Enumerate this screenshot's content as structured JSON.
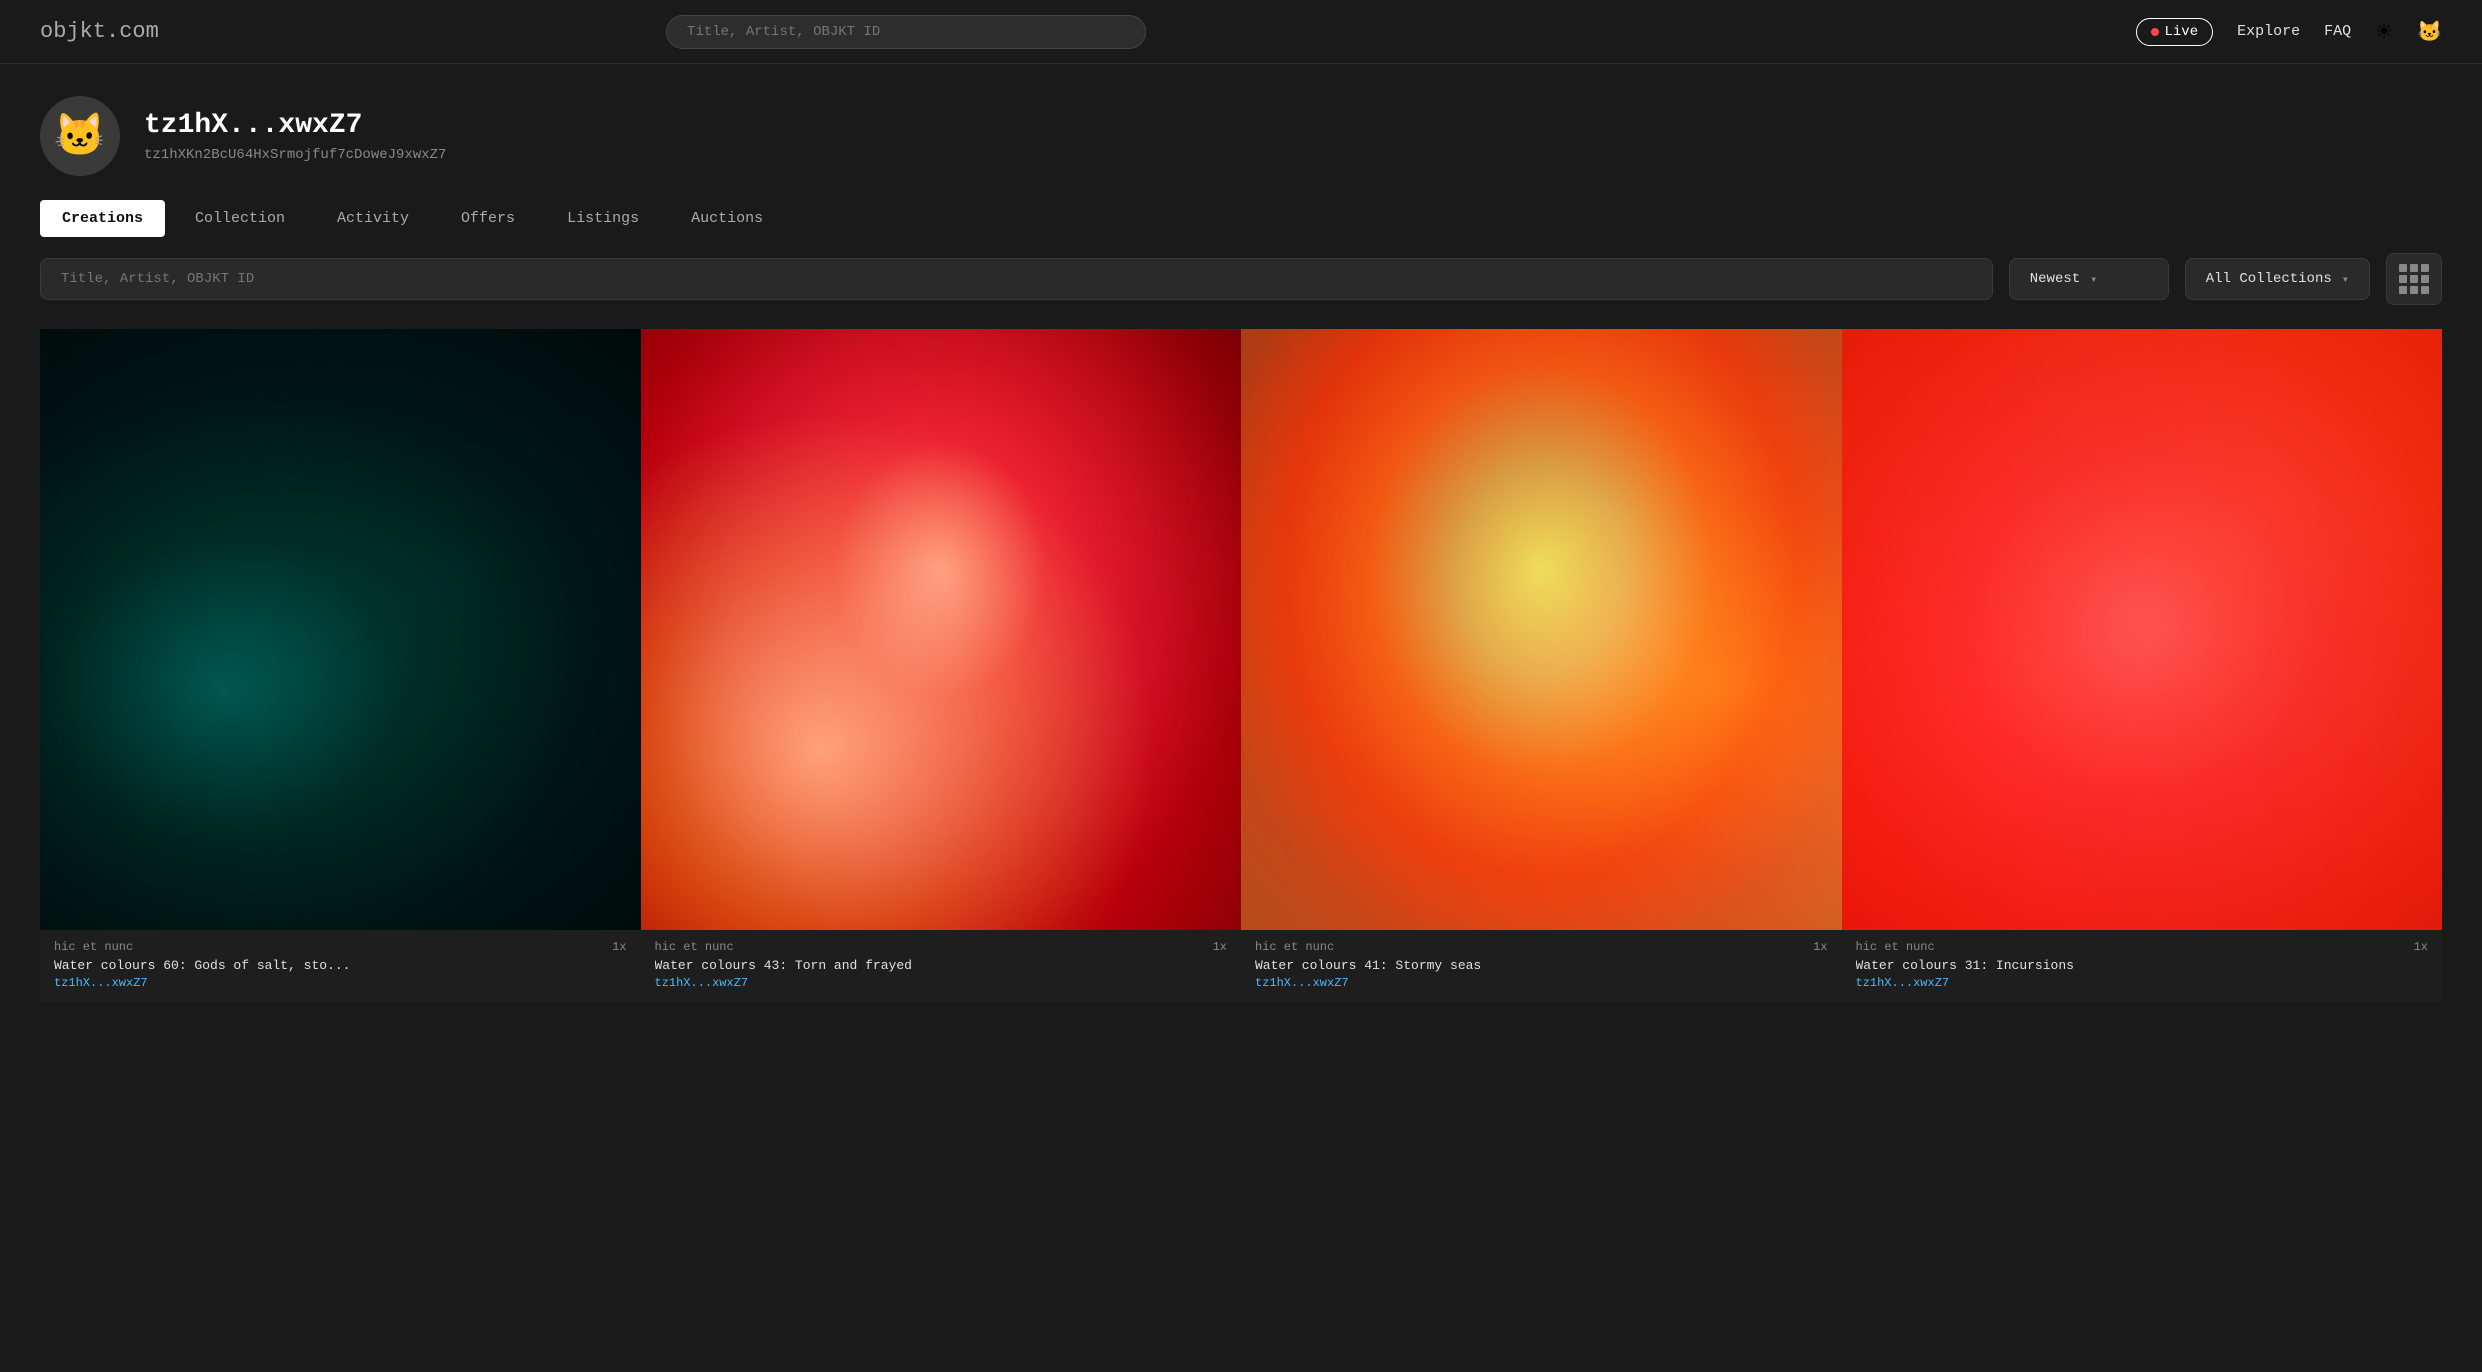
{
  "logo": {
    "brand": "objkt",
    "tld": ".com"
  },
  "header": {
    "search_placeholder": "Title, Artist, OBJKT ID",
    "live_label": "Live",
    "explore_label": "Explore",
    "faq_label": "FAQ",
    "theme_icon": "☀",
    "avatar_icon": "🐱"
  },
  "profile": {
    "display_name": "tz1hX...xwxZ7",
    "full_address": "tz1hXKn2BcU64HxSrmojfuf7cDoweJ9xwxZ7",
    "avatar_emoji": "🐱"
  },
  "tabs": [
    {
      "label": "Creations",
      "active": true
    },
    {
      "label": "Collection",
      "active": false
    },
    {
      "label": "Activity",
      "active": false
    },
    {
      "label": "Offers",
      "active": false
    },
    {
      "label": "Listings",
      "active": false
    },
    {
      "label": "Auctions",
      "active": false
    }
  ],
  "filters": {
    "search_placeholder": "Title, Artist, OBJKT ID",
    "sort_label": "Newest",
    "collection_label": "All Collections"
  },
  "artworks": [
    {
      "id": 0,
      "collection": "hic et nunc",
      "edition": "1x",
      "title": "Water colours 60: Gods of salt, sto...",
      "artist": "tz1hX...xwxZ7",
      "style_class": "artwork-0"
    },
    {
      "id": 1,
      "collection": "hic et nunc",
      "edition": "1x",
      "title": "Water colours 43: Torn and frayed",
      "artist": "tz1hX...xwxZ7",
      "style_class": "artwork-1"
    },
    {
      "id": 2,
      "collection": "hic et nunc",
      "edition": "1x",
      "title": "Water colours 41: Stormy seas",
      "artist": "tz1hX...xwxZ7",
      "style_class": "artwork-2"
    },
    {
      "id": 3,
      "collection": "hic et nunc",
      "edition": "1x",
      "title": "Water colours 31: Incursions",
      "artist": "tz1hX...xwxZ7",
      "style_class": "artwork-3"
    }
  ]
}
